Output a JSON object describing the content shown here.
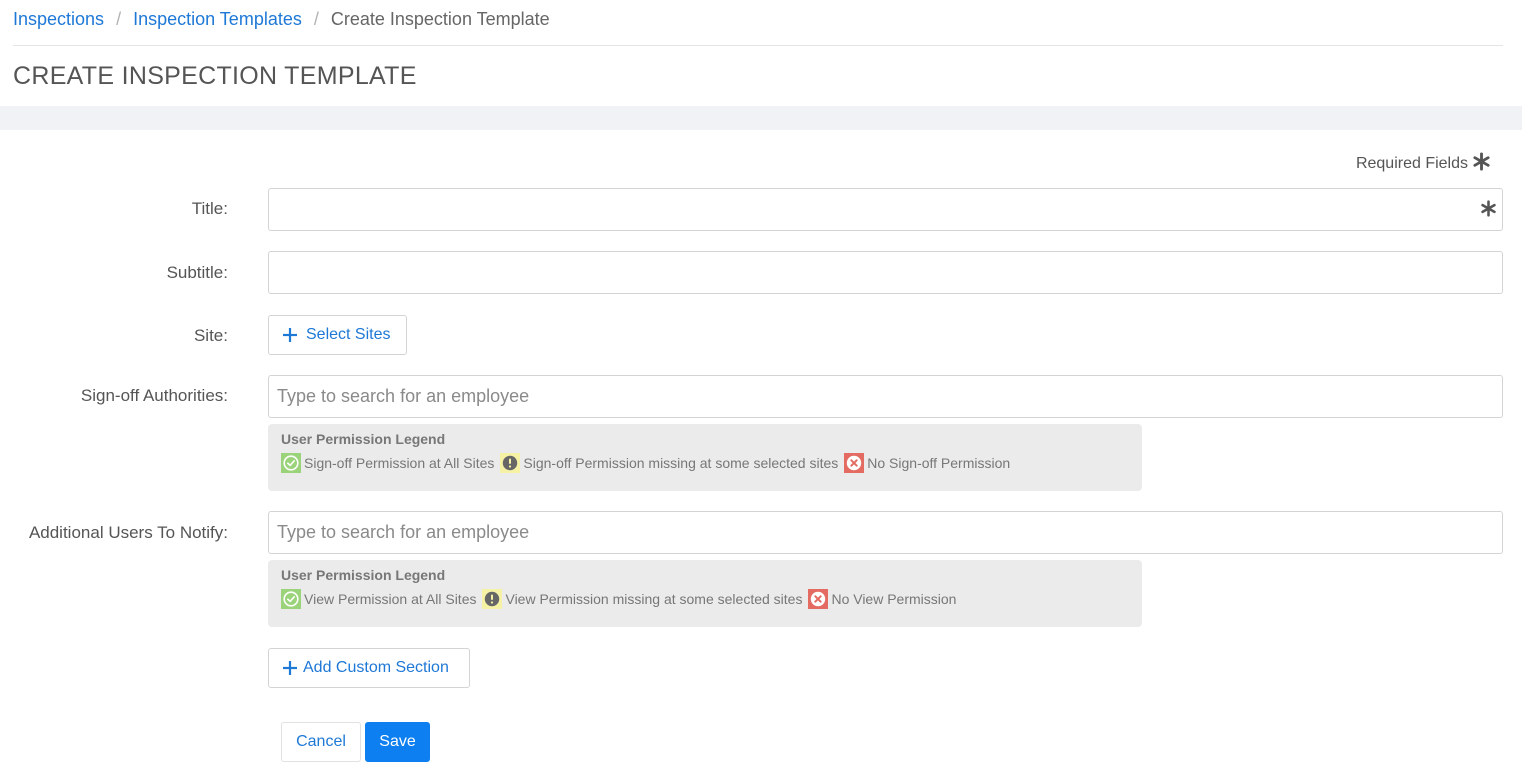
{
  "breadcrumb": {
    "items": [
      "Inspections",
      "Inspection Templates"
    ],
    "separator": "/",
    "current": "Create Inspection Template"
  },
  "page_title": "CREATE INSPECTION TEMPLATE",
  "required_fields_label": "Required Fields",
  "form": {
    "title": {
      "label": "Title:",
      "value": "",
      "placeholder": ""
    },
    "subtitle": {
      "label": "Subtitle:",
      "value": "",
      "placeholder": ""
    },
    "site": {
      "label": "Site:",
      "button_label": "Select Sites"
    },
    "signoff": {
      "label": "Sign-off Authorities:",
      "placeholder": "Type to search for an employee",
      "legend": {
        "title": "User Permission Legend",
        "items": [
          {
            "icon": "check-circle-icon",
            "color": "#9bd37a",
            "text": "Sign-off Permission at All Sites"
          },
          {
            "icon": "exclamation-circle-icon",
            "color": "#f5f2a6",
            "text": "Sign-off Permission missing at some selected sites"
          },
          {
            "icon": "x-circle-icon",
            "color": "#e46b61",
            "text": "No Sign-off Permission"
          }
        ]
      }
    },
    "notify": {
      "label": "Additional Users To Notify:",
      "placeholder": "Type to search for an employee",
      "legend": {
        "title": "User Permission Legend",
        "items": [
          {
            "icon": "check-circle-icon",
            "color": "#9bd37a",
            "text": "View Permission at All Sites"
          },
          {
            "icon": "exclamation-circle-icon",
            "color": "#f5f2a6",
            "text": "View Permission missing at some selected sites"
          },
          {
            "icon": "x-circle-icon",
            "color": "#e46b61",
            "text": "No View Permission"
          }
        ]
      }
    },
    "add_section_label": "Add Custom Section"
  },
  "actions": {
    "cancel": "Cancel",
    "save": "Save"
  },
  "colors": {
    "link": "#1e78d6",
    "primary": "#0d7ff0",
    "band": "#f0f2f6"
  }
}
